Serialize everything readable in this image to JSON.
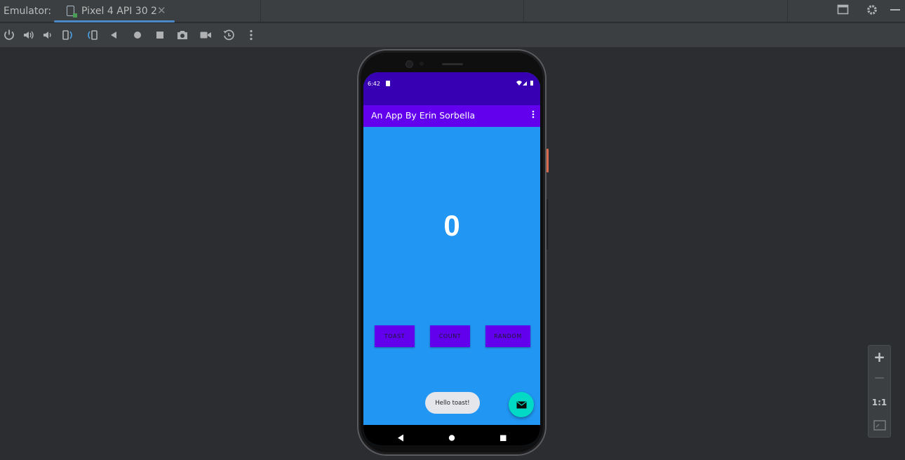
{
  "window": {
    "tool_label": "Emulator:",
    "device_tab": "Pixel 4 API 30 2",
    "close_symbol": "✕"
  },
  "toolbar": {
    "icons": [
      "power-icon",
      "volume-up-icon",
      "volume-down-icon",
      "rotate-left-icon",
      "rotate-right-icon",
      "back-icon",
      "home-icon",
      "overview-icon",
      "screenshot-icon",
      "screen-record-icon",
      "snapshot-icon",
      "more-icon"
    ]
  },
  "phone": {
    "status_time": "6:42",
    "app_title": "An App By Erin Sorbella",
    "counter_value": "0",
    "buttons": {
      "toast": "TOAST",
      "count": "COUNT",
      "random": "RANDOM"
    },
    "toast_message": "Hello toast!",
    "colors": {
      "status_bar": "#3700b3",
      "app_bar": "#6200ee",
      "background": "#2196f3",
      "button": "#6200ee",
      "fab": "#03dac5"
    }
  },
  "zoom": {
    "zoom_in": "+",
    "zoom_out": "—",
    "actual_size": "1:1"
  }
}
